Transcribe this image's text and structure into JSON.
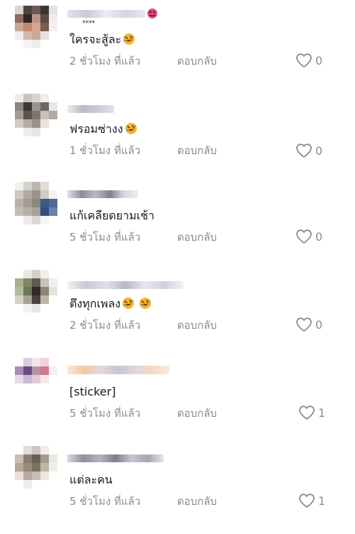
{
  "comments": [
    {
      "text": "ใครจะสู้ละ",
      "emoji_count": 1,
      "time": "2 ชั่วโมง ที่แล้ว",
      "reply": "ตอบกลับ",
      "likes": "0",
      "username_partial": "****"
    },
    {
      "text": "ฟรอมซ่างง",
      "emoji_count": 1,
      "time": "1 ชั่วโมง ที่แล้ว",
      "reply": "ตอบกลับ",
      "likes": "0"
    },
    {
      "text": "แก้เคลียดยามเช้า",
      "emoji_count": 0,
      "time": "5 ชั่วโมง ที่แล้ว",
      "reply": "ตอบกลับ",
      "likes": "0"
    },
    {
      "text": "ตึงทุกเพลง",
      "emoji_count": 2,
      "time": "2 ชั่วโมง ที่แล้ว",
      "reply": "ตอบกลับ",
      "likes": "0"
    },
    {
      "text": "[sticker]",
      "emoji_count": 0,
      "time": "5 ชั่วโมง ที่แล้ว",
      "reply": "ตอบกลับ",
      "likes": "1"
    },
    {
      "text": "แต่ละคน",
      "emoji_count": 0,
      "time": "5 ชั่วโมง ที่แล้ว",
      "reply": "ตอบกลับ",
      "likes": "1"
    }
  ],
  "colors": {
    "text": "#161823",
    "meta": "#8a8b91",
    "emoji_face": "#f7b52a",
    "emoji_tear": "#4aa3df",
    "emoji_mouth": "#7a3b12"
  },
  "icons": {
    "like": "heart-outline-icon",
    "emoji": "rolling-on-floor-laughing-emoji"
  }
}
